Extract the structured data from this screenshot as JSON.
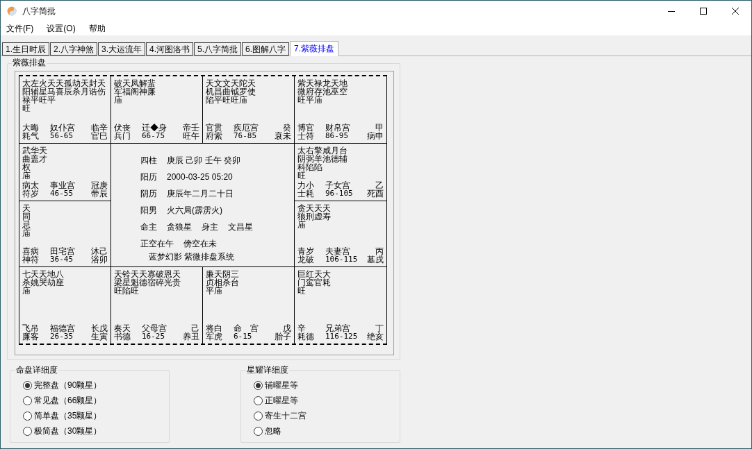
{
  "window": {
    "title": "八字简批"
  },
  "menu": [
    "文件(F)",
    "设置(O)",
    "帮助"
  ],
  "tabs": [
    {
      "label": "1.生日时辰",
      "selected": false
    },
    {
      "label": "2.八字神煞",
      "selected": false
    },
    {
      "label": "3.大运流年",
      "selected": false
    },
    {
      "label": "4.河图洛书",
      "selected": false
    },
    {
      "label": "5.八字简批",
      "selected": false
    },
    {
      "label": "6.图解八字",
      "selected": false
    },
    {
      "label": "7.紫薇排盘",
      "selected": true
    }
  ],
  "chart_group": {
    "title": "紫薇排盘",
    "palaces": [
      {
        "stars": [
          "太左火天天孤劫天封天",
          "阳辅星马喜辰杀月诰伤",
          "禄平旺平",
          "旺"
        ],
        "left": [
          "大晦",
          "耗气"
        ],
        "name": "奴仆宫",
        "range": "56-65",
        "right": [
          "临辛",
          "官巳"
        ]
      },
      {
        "stars": [
          "破天凤解蜚",
          "军福阁神廉",
          "庙"
        ],
        "left": [
          "伏丧",
          "兵门"
        ],
        "name": "迁◆身",
        "range": "66-75",
        "right": [
          "帝壬",
          "旺午"
        ]
      },
      {
        "stars": [
          "天文文天陀天",
          "机昌曲钺罗使",
          "陷平旺旺庙"
        ],
        "left": [
          "官贯",
          "府索"
        ],
        "name": "疾厄宫",
        "range": "76-85",
        "right": [
          "癸",
          "衰未"
        ]
      },
      {
        "stars": [
          "紫天禄龙天地",
          "微府存池巫空",
          "旺平庙"
        ],
        "left": [
          "博官",
          "士符"
        ],
        "name": "财帛宫",
        "range": "86-95",
        "right": [
          "甲",
          "病申"
        ]
      },
      {
        "stars": [
          "武华天",
          "曲盖才",
          "权",
          "庙"
        ],
        "left": [
          "病太",
          "符岁"
        ],
        "name": "事业宫",
        "range": "46-55",
        "right": [
          "冠庚",
          "带辰"
        ]
      },
      {
        "stars": [
          "太右擎咸月台",
          "阴弼羊池德辅",
          "科陷陷",
          "旺"
        ],
        "left": [
          "力小",
          "士耗"
        ],
        "name": "子女宫",
        "range": "96-105",
        "right": [
          "乙",
          "死酉"
        ]
      },
      {
        "stars": [
          "天",
          "同",
          "忌",
          "庙"
        ],
        "left": [
          "喜病",
          "神符"
        ],
        "name": "田宅宫",
        "range": "36-45",
        "right": [
          "沐己",
          "浴卯"
        ]
      },
      {
        "stars": [
          "贪天天天",
          "狼刑虚寿",
          "庙"
        ],
        "left": [
          "青岁",
          "龙破"
        ],
        "name": "夫妻宫",
        "range": "106-115",
        "right": [
          "丙",
          "墓戌"
        ]
      },
      {
        "stars": [
          "七天天地八",
          "杀姚哭劫座",
          "庙"
        ],
        "left": [
          "飞吊",
          "廉客"
        ],
        "name": "福德宫",
        "range": "26-35",
        "right": [
          "长戊",
          "生寅"
        ]
      },
      {
        "stars": [
          "天铃天天寡破恩天",
          "梁星魁德宿碎光贵",
          "旺陷旺"
        ],
        "left": [
          "奏天",
          "书德"
        ],
        "name": "父母宫",
        "range": "16-25",
        "right": [
          "己",
          "养丑"
        ]
      },
      {
        "stars": [
          "廉天阴三",
          "贞相杀台",
          "平庙"
        ],
        "left": [
          "将白",
          "军虎"
        ],
        "name": "命　宫",
        "range": "6-15",
        "right": [
          "戊",
          "胎子"
        ]
      },
      {
        "stars": [
          "巨红天大",
          "门鸾官耗",
          "旺"
        ],
        "left": [
          "辛",
          "耗德"
        ],
        "name": "兄弟宫",
        "range": "116-125",
        "right": [
          "丁",
          "绝亥"
        ]
      }
    ],
    "center": [
      [
        "四柱",
        "庚辰 己卯 壬午 癸卯"
      ],
      [
        "阳历",
        "2000-03-25 05:20"
      ],
      [
        "阴历",
        "庚辰年二月二十日"
      ],
      [
        "阳男",
        "火六局(霹雳火)"
      ],
      [
        "命主",
        "贪狼星",
        "身主",
        "文昌星"
      ],
      [
        "正空在午",
        "傍空在未"
      ]
    ],
    "footer": "蓝梦幻影 紫微排盘系统"
  },
  "detail_group": {
    "title": "命盘详细度",
    "options": [
      {
        "label": "完整盘（90颗星）",
        "selected": true
      },
      {
        "label": "常见盘（66颗星）",
        "selected": false
      },
      {
        "label": "简单盘（35颗星）",
        "selected": false
      },
      {
        "label": "极简盘（30颗星）",
        "selected": false
      }
    ]
  },
  "star_group": {
    "title": "星耀详细度",
    "options": [
      {
        "label": "辅曜星等",
        "selected": true
      },
      {
        "label": "正曜星等",
        "selected": false
      },
      {
        "label": "寄生十二宫",
        "selected": false
      },
      {
        "label": "忽略",
        "selected": false
      }
    ]
  }
}
